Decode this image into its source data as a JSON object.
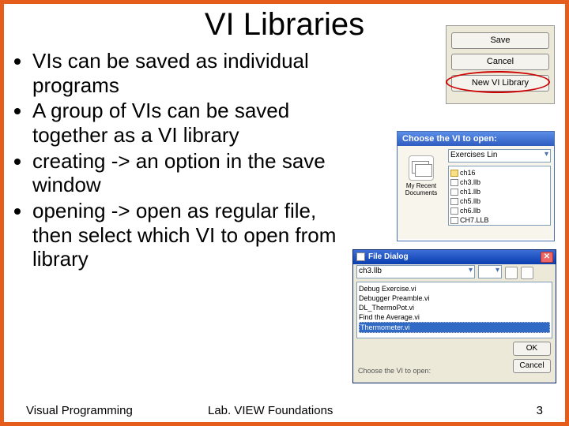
{
  "slide": {
    "title": "VI Libraries",
    "bullets": [
      "VIs can be saved as individual programs",
      "A group of VIs can be saved together as a VI library",
      "creating -> an option in the save window",
      "opening -> open as regular file, then select which VI to open from library"
    ]
  },
  "save_panel": {
    "save": "Save",
    "cancel": "Cancel",
    "newlib": "New VI Library"
  },
  "choose_dialog": {
    "title": "Choose the VI to open:",
    "dropdown": "Exercises Lin",
    "left_label": "My Recent Documents",
    "files": [
      "ch16",
      "ch3.llb",
      "ch1.llb",
      "ch5.llb",
      "ch6.llb",
      "CH7.LLB"
    ]
  },
  "file_dialog": {
    "title": "File Dialog",
    "dropdown": "ch3.llb",
    "dropdown2": "",
    "items": [
      "Debug Exercise.vi",
      "Debugger Preamble.vi",
      "DL_ThermoPot.vi",
      "Find the Average.vi",
      "Thermometer.vi"
    ],
    "selected_index": 4,
    "bottom_label": "Choose the VI to open:",
    "ok": "OK",
    "cancel": "Cancel"
  },
  "footer": {
    "left": "Visual Programming",
    "center": "Lab. VIEW Foundations",
    "page": "3"
  }
}
